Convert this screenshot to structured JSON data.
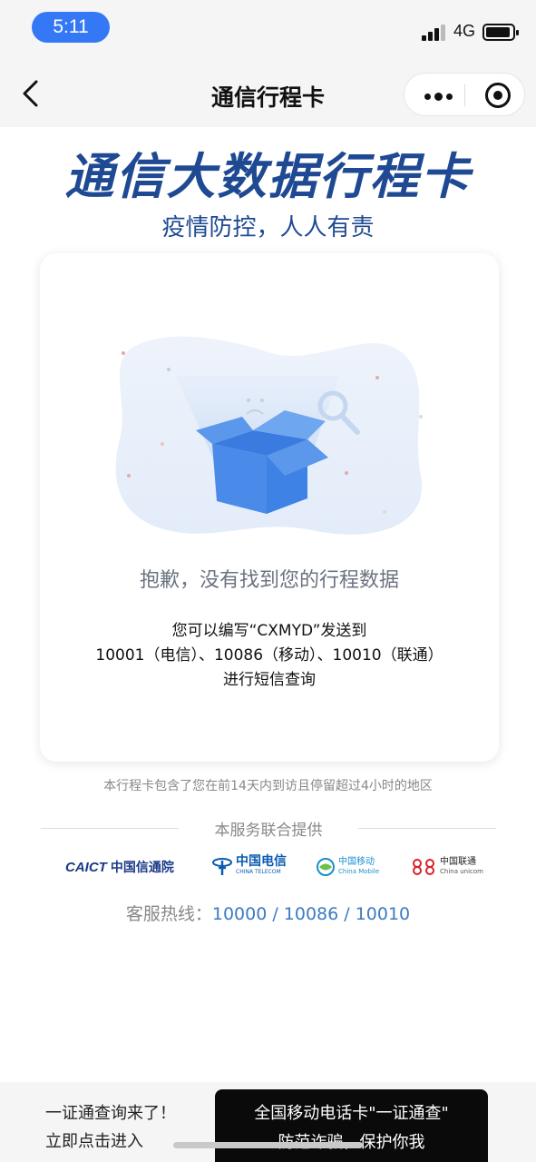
{
  "status_bar": {
    "time": "5:11",
    "network": "4G"
  },
  "nav": {
    "title": "通信行程卡"
  },
  "header": {
    "title": "通信大数据行程卡",
    "subtitle": "疫情防控，人人有责"
  },
  "card": {
    "empty_message": "抱歉，没有找到您的行程数据",
    "instructions": [
      "您可以编写“CXMYD”发送到",
      "10001（电信）、10086（移动）、10010（联通）",
      "进行短信查询"
    ]
  },
  "footnote": "本行程卡包含了您在前14天内到访且停留超过4小时的地区",
  "providers": {
    "label": "本服务联合提供",
    "logos": [
      {
        "en": "CAICT",
        "cn": "中国信通院"
      },
      {
        "cn": "中国电信",
        "en": "CHINA TELECOM"
      },
      {
        "cn": "中国移动",
        "en": "China Mobile"
      },
      {
        "cn": "中国联通",
        "en": "China unicom"
      }
    ]
  },
  "hotline": {
    "label": "客服热线：",
    "numbers": "10000 / 10086 / 10010"
  },
  "bottom_bar": {
    "promo_title": "一证通查询来了！",
    "promo_sub": "立即点击进入",
    "toast_line1": "全国移动电话卡\"一证通查\"",
    "toast_line2": "防范诈骗，保护你我"
  },
  "colors": {
    "brand_blue": "#1f4a93",
    "time_pill": "#3478f6",
    "hotline_blue": "#3c7ac3"
  }
}
